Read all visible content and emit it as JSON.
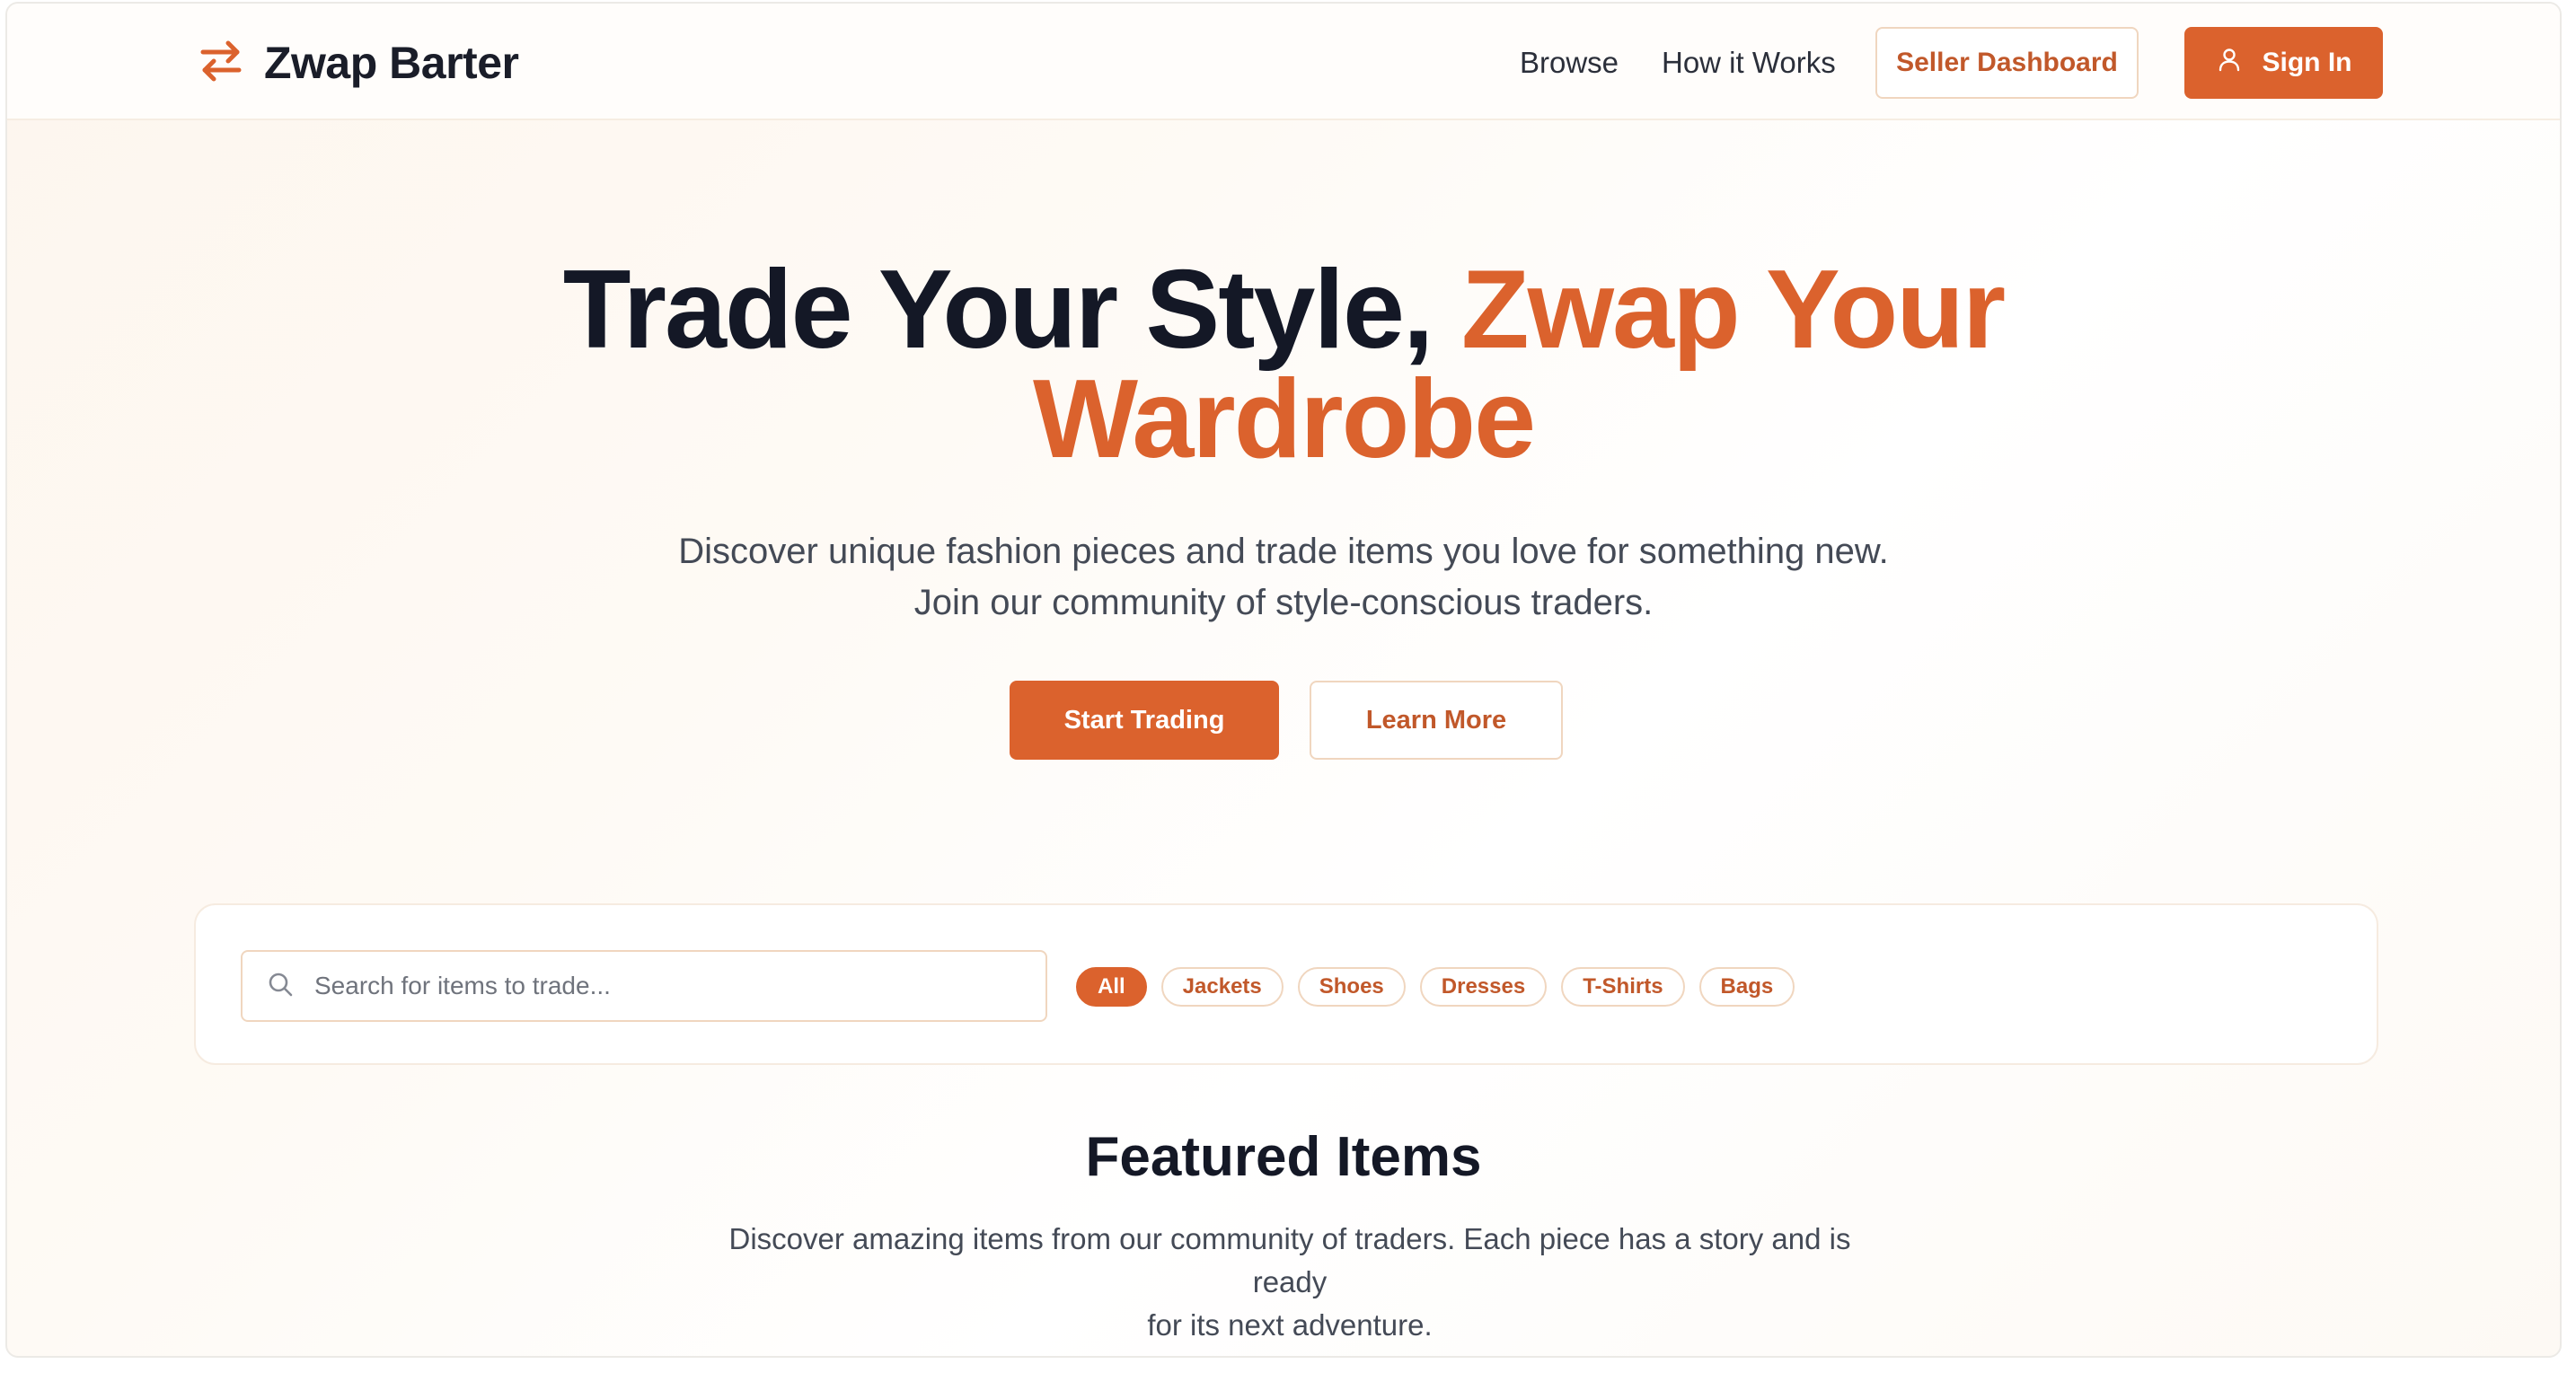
{
  "header": {
    "logo_text": "Zwap Barter",
    "logo_icon": "swap-arrows-icon",
    "nav": [
      {
        "label": "Browse"
      },
      {
        "label": "How it Works"
      }
    ],
    "seller_dashboard_label": "Seller Dashboard",
    "sign_in_label": "Sign In",
    "sign_in_icon": "user-icon"
  },
  "hero": {
    "title_part1": "Trade Your Style, ",
    "title_accent_line1": "Zwap Your",
    "title_accent_line2": "Wardrobe",
    "subtitle_line1": "Discover unique fashion pieces and trade items you love for something new.",
    "subtitle_line2": "Join our community of style-conscious traders.",
    "primary_cta": "Start Trading",
    "secondary_cta": "Learn More"
  },
  "filters": {
    "search_icon": "search-icon",
    "search_value": "",
    "search_placeholder": "Search for items to trade...",
    "categories": [
      {
        "label": "All",
        "active": true
      },
      {
        "label": "Jackets",
        "active": false
      },
      {
        "label": "Shoes",
        "active": false
      },
      {
        "label": "Dresses",
        "active": false
      },
      {
        "label": "T-Shirts",
        "active": false
      },
      {
        "label": "Bags",
        "active": false
      }
    ]
  },
  "featured": {
    "title": "Featured Items",
    "subtitle_line1": "Discover amazing items from our community of traders. Each piece has a story and is ready",
    "subtitle_line2": "for its next adventure."
  },
  "colors": {
    "accent": "#db622d",
    "accent_text": "#c1582a",
    "heading": "#141826",
    "body_text": "#444a56",
    "border_soft": "#f0d6bf"
  }
}
